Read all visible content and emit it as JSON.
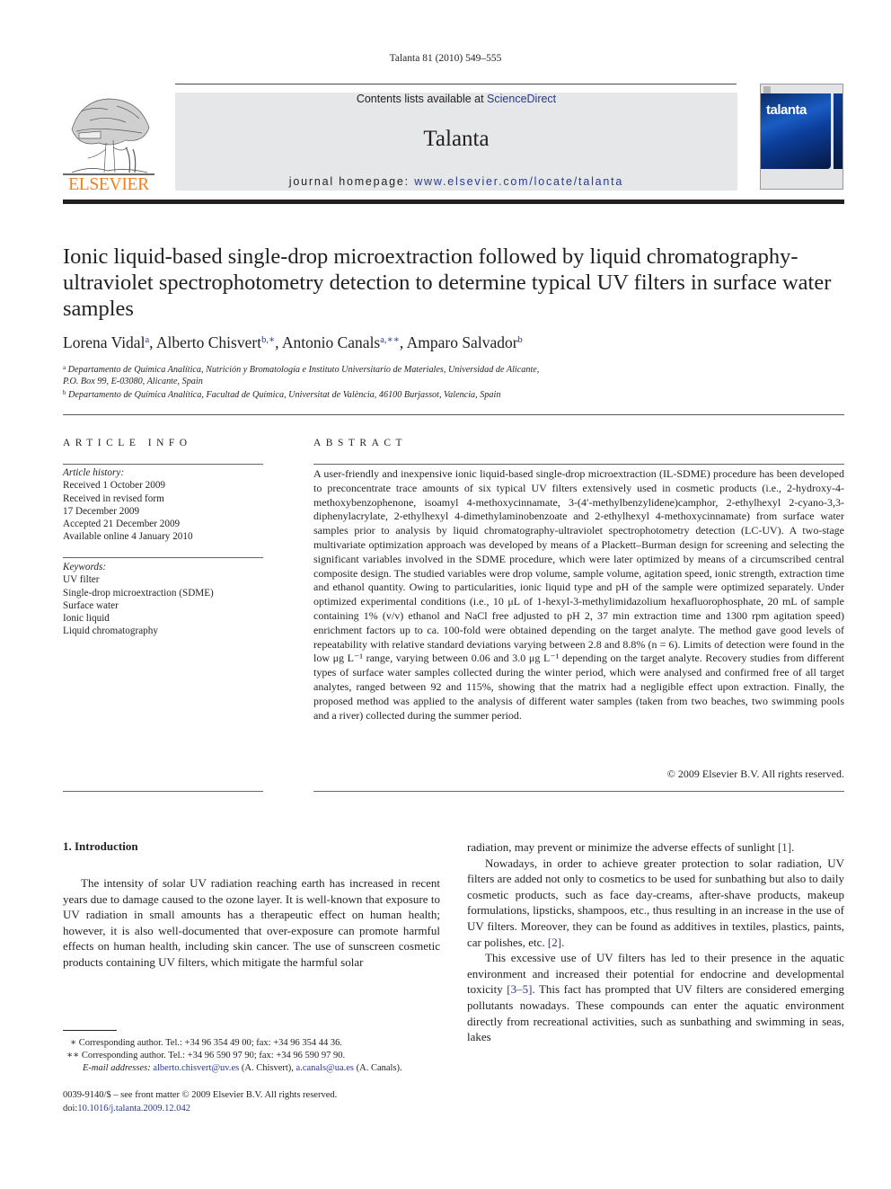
{
  "running_head": "Talanta 81 (2010) 549–555",
  "header": {
    "contents_prefix": "Contents lists available at ",
    "contents_link": "ScienceDirect",
    "journal_name": "Talanta",
    "homepage_prefix": "journal homepage: ",
    "homepage_link": "www.elsevier.com/locate/talanta",
    "publisher_logo_text": "ELSEVIER",
    "cover_title": "talanta",
    "colors": {
      "link": "#2a3a8c",
      "publisher_orange": "#f07f1d",
      "banner_bg": "#e6e7e8"
    }
  },
  "article": {
    "title": "Ionic liquid-based single-drop microextraction followed by liquid chromatography-ultraviolet spectrophotometry detection to determine typical UV filters in surface water samples",
    "authors": [
      {
        "name": "Lorena Vidal",
        "marks": "a"
      },
      {
        "name": "Alberto Chisvert",
        "marks": "b,∗"
      },
      {
        "name": "Antonio Canals",
        "marks": "a,∗∗"
      },
      {
        "name": "Amparo Salvador",
        "marks": "b"
      }
    ],
    "affiliations": {
      "a_mark": "a",
      "a_line1": "Departamento de Química Analítica, Nutrición y Bromatología e Instituto Universitario de Materiales, Universidad de Alicante,",
      "a_line2": "P.O. Box 99, E-03080, Alicante, Spain",
      "b_mark": "b",
      "b_line": "Departamento de Química Analítica, Facultad de Química, Universitat de València, 46100 Burjassot, Valencia, Spain"
    }
  },
  "article_info": {
    "heading": "ARTICLE INFO",
    "history_label": "Article history:",
    "history": [
      "Received 1 October 2009",
      "Received in revised form",
      "17 December 2009",
      "Accepted 21 December 2009",
      "Available online 4 January 2010"
    ],
    "keywords_label": "Keywords:",
    "keywords": [
      "UV filter",
      "Single-drop microextraction (SDME)",
      "Surface water",
      "Ionic liquid",
      "Liquid chromatography"
    ]
  },
  "abstract": {
    "heading": "ABSTRACT",
    "text": "A user-friendly and inexpensive ionic liquid-based single-drop microextraction (IL-SDME) pro­cedure has been developed to preconcentrate trace amounts of six typical UV filters extensively used in cosmetic products (i.e., 2-hydroxy-4-methoxybenzophenone, isoamyl 4-methoxycinnamate, 3-(4′-methylbenzylidene)camphor, 2-ethylhexyl 2-cyano-3,3-diphenylacrylate, 2-ethylhexyl 4-dimethylaminobenzoate and 2-ethylhexyl 4-methoxycinnamate) from surface water samples prior to analysis by liquid chromatography-ultraviolet spectrophotometry detection (LC-UV). A two-stage multivariate optimization approach was developed by means of a Plackett–Burman design for screening and selecting the significant variables involved in the SDME procedure, which were later optimized by means of a circumscribed central composite design. The studied variables were drop volume, sample volume, agitation speed, ionic strength, extraction time and ethanol quantity. Owing to particularities, ionic liquid type and pH of the sample were optimized separately. Under optimized experimental con­ditions (i.e., 10 μL of 1-hexyl-3-methylimidazolium hexafluorophosphate, 20 mL of sample containing 1% (v/v) ethanol and NaCl free adjusted to pH 2, 37 min extraction time and 1300 rpm agitation speed) enrichment factors up to ca. 100-fold were obtained depending on the target analyte. The method gave good levels of repeatability with relative standard deviations varying between 2.8 and 8.8% (n = 6). Limits of detection were found in the low μg L⁻¹ range, varying between 0.06 and 3.0 μg L⁻¹ depending on the target analyte. Recovery studies from different types of surface water samples collected during the winter period, which were analysed and confirmed free of all target analytes, ranged between 92 and 115%, showing that the matrix had a negligible effect upon extraction. Finally, the proposed method was applied to the analysis of different water samples (taken from two beaches, two swimming pools and a river) collected during the summer period.",
    "copyright": "© 2009 Elsevier B.V. All rights reserved."
  },
  "body": {
    "intro_heading": "1.  Introduction",
    "left_paragraph": "The intensity of solar UV radiation reaching earth has increased in recent years due to damage caused to the ozone layer. It is well-known that exposure to UV radiation in small amounts has a therapeutic effect on human health; however, it is also well-documented that over-exposure can promote harmful effects on human health, including skin cancer. The use of sunscreen cosmetic products containing UV filters, which mitigate the harmful solar",
    "right_p1_text": "radiation, may prevent or minimize the adverse effects of sunlight ",
    "right_p1_ref": "[1]",
    "right_p1_end": ".",
    "right_p2_text": "Nowadays, in order to achieve greater protection to solar radi­ation, UV filters are added not only to cosmetics to be used for sunbathing but also to daily cosmetic products, such as face day-creams, after-shave products, makeup formulations, lipsticks, shampoos, etc., thus resulting in an increase in the use of UV filters. Moreover, they can be found as additives in textiles, plastics, paints, car polishes, etc. ",
    "right_p2_ref": "[2]",
    "right_p2_end": ".",
    "right_p3_text": "This excessive use of UV filters has led to their presence in the aquatic environment and increased their potential for endocrine and developmental toxicity ",
    "right_p3_ref": "[3–5]",
    "right_p3_end": ". This fact has prompted that UV filters are considered emerging pollutants nowadays. These compounds can enter the aquatic environment directly from recre­ational activities, such as sunbathing and swimming in seas, lakes"
  },
  "footnotes": {
    "fn1_mark": "∗",
    "fn1_text": "Corresponding author. Tel.: +34 96 354 49 00; fax: +34 96 354 44 36.",
    "fn2_mark": "∗∗",
    "fn2_text": "Corresponding author. Tel.: +34 96 590 97 90; fax: +34 96 590 97 90.",
    "email_label": "E-mail addresses:",
    "email1": "alberto.chisvert@uv.es",
    "email1_owner": " (A. Chisvert), ",
    "email2": "a.canals@ua.es",
    "email2_owner": " (A. Canals).",
    "front_matter": "0039-9140/$ – see front matter © 2009 Elsevier B.V. All rights reserved.",
    "doi_prefix": "doi:",
    "doi_link": "10.1016/j.talanta.2009.12.042"
  }
}
